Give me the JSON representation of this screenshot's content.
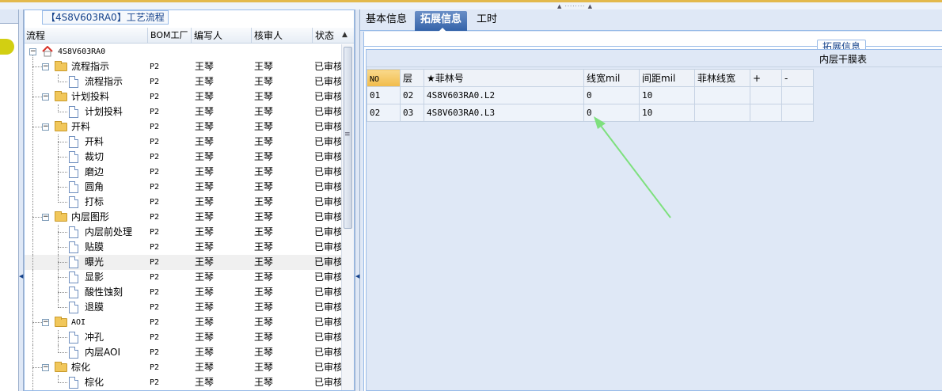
{
  "tree_panel": {
    "title": "【4S8V603RA0】工艺流程",
    "columns": [
      "流程",
      "BOM工厂",
      "编写人",
      "核审人",
      "状态"
    ],
    "rows": [
      {
        "name": "4S8V603RA0",
        "type": "root",
        "level": 0,
        "bom": "",
        "author": "",
        "reviewer": "",
        "status": ""
      },
      {
        "name": "流程指示",
        "type": "folder",
        "level": 1,
        "bom": "P2",
        "author": "王琴",
        "reviewer": "王琴",
        "status": "已审核"
      },
      {
        "name": "流程指示",
        "type": "doc",
        "level": 2,
        "bom": "P2",
        "author": "王琴",
        "reviewer": "王琴",
        "status": "已审核"
      },
      {
        "name": "计划投料",
        "type": "folder",
        "level": 1,
        "bom": "P2",
        "author": "王琴",
        "reviewer": "王琴",
        "status": "已审核"
      },
      {
        "name": "计划投料",
        "type": "doc",
        "level": 2,
        "bom": "P2",
        "author": "王琴",
        "reviewer": "王琴",
        "status": "已审核"
      },
      {
        "name": "开料",
        "type": "folder",
        "level": 1,
        "bom": "P2",
        "author": "王琴",
        "reviewer": "王琴",
        "status": "已审核"
      },
      {
        "name": "开料",
        "type": "doc",
        "level": 2,
        "bom": "P2",
        "author": "王琴",
        "reviewer": "王琴",
        "status": "已审核"
      },
      {
        "name": "裁切",
        "type": "doc",
        "level": 2,
        "bom": "P2",
        "author": "王琴",
        "reviewer": "王琴",
        "status": "已审核"
      },
      {
        "name": "磨边",
        "type": "doc",
        "level": 2,
        "bom": "P2",
        "author": "王琴",
        "reviewer": "王琴",
        "status": "已审核"
      },
      {
        "name": "圆角",
        "type": "doc",
        "level": 2,
        "bom": "P2",
        "author": "王琴",
        "reviewer": "王琴",
        "status": "已审核"
      },
      {
        "name": "打标",
        "type": "doc",
        "level": 2,
        "bom": "P2",
        "author": "王琴",
        "reviewer": "王琴",
        "status": "已审核"
      },
      {
        "name": "内层图形",
        "type": "folder",
        "level": 1,
        "bom": "P2",
        "author": "王琴",
        "reviewer": "王琴",
        "status": "已审核"
      },
      {
        "name": "内层前处理",
        "type": "doc",
        "level": 2,
        "bom": "P2",
        "author": "王琴",
        "reviewer": "王琴",
        "status": "已审核"
      },
      {
        "name": "贴膜",
        "type": "doc",
        "level": 2,
        "bom": "P2",
        "author": "王琴",
        "reviewer": "王琴",
        "status": "已审核"
      },
      {
        "name": "曝光",
        "type": "doc",
        "level": 2,
        "bom": "P2",
        "author": "王琴",
        "reviewer": "王琴",
        "status": "已审核",
        "selected": true
      },
      {
        "name": "显影",
        "type": "doc",
        "level": 2,
        "bom": "P2",
        "author": "王琴",
        "reviewer": "王琴",
        "status": "已审核"
      },
      {
        "name": "酸性蚀刻",
        "type": "doc",
        "level": 2,
        "bom": "P2",
        "author": "王琴",
        "reviewer": "王琴",
        "status": "已审核"
      },
      {
        "name": "退膜",
        "type": "doc",
        "level": 2,
        "bom": "P2",
        "author": "王琴",
        "reviewer": "王琴",
        "status": "已审核"
      },
      {
        "name": "AOI",
        "type": "folder",
        "level": 1,
        "bom": "P2",
        "author": "王琴",
        "reviewer": "王琴",
        "status": "已审核"
      },
      {
        "name": "冲孔",
        "type": "doc",
        "level": 2,
        "bom": "P2",
        "author": "王琴",
        "reviewer": "王琴",
        "status": "已审核"
      },
      {
        "name": "内层AOI",
        "type": "doc",
        "level": 2,
        "bom": "P2",
        "author": "王琴",
        "reviewer": "王琴",
        "status": "已审核"
      },
      {
        "name": "棕化",
        "type": "folder",
        "level": 1,
        "bom": "P2",
        "author": "王琴",
        "reviewer": "王琴",
        "status": "已审核"
      },
      {
        "name": "棕化",
        "type": "doc",
        "level": 2,
        "bom": "P2",
        "author": "王琴",
        "reviewer": "王琴",
        "status": "已审核"
      }
    ]
  },
  "tabs": [
    {
      "label": "基本信息",
      "active": false
    },
    {
      "label": "拓展信息",
      "active": true
    },
    {
      "label": "工时",
      "active": false
    }
  ],
  "extended": {
    "legend": "拓展信息",
    "grid_caption": "内层干膜表",
    "columns": [
      "NO",
      "层",
      "★菲林号",
      "线宽mil",
      "间距mil",
      "菲林线宽",
      "+",
      "-"
    ],
    "rows": [
      {
        "no": "01",
        "layer": "02",
        "film": "4S8V603RA0.L2",
        "line_width": "0",
        "spacing": "10",
        "film_width": ""
      },
      {
        "no": "02",
        "layer": "03",
        "film": "4S8V603RA0.L3",
        "line_width": "0",
        "spacing": "10",
        "film_width": ""
      }
    ]
  },
  "colors": {
    "accent": "#3463a9",
    "panel_bg": "#dfe8f6",
    "header_highlight": "#f1bb4a",
    "annotation_arrow": "#7ee07e",
    "top_border": "#e3b94c"
  }
}
